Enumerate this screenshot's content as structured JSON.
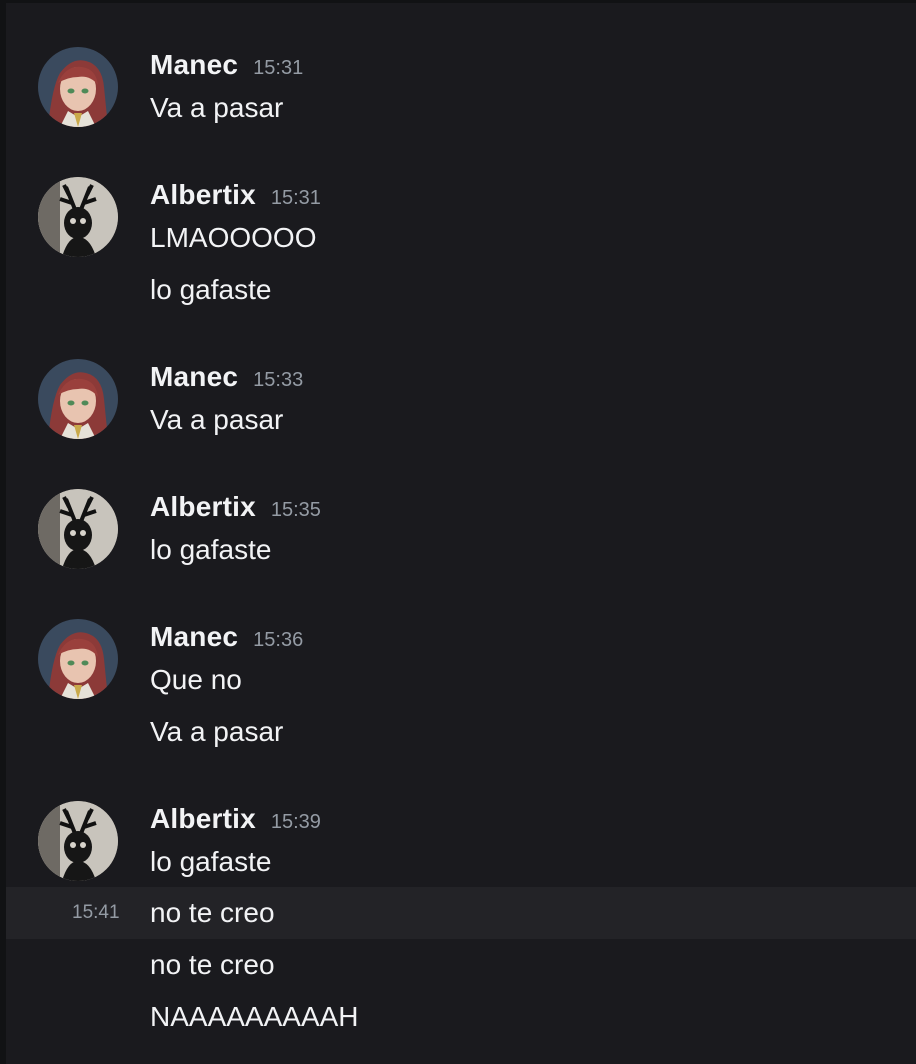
{
  "messages": [
    {
      "author": "Manec",
      "time": "15:31",
      "lines": [
        "Va a pasar"
      ]
    },
    {
      "author": "Albertix",
      "time": "15:31",
      "lines": [
        "LMAOOOOO",
        "lo gafaste"
      ]
    },
    {
      "author": "Manec",
      "time": "15:33",
      "lines": [
        "Va a pasar"
      ]
    },
    {
      "author": "Albertix",
      "time": "15:35",
      "lines": [
        "lo gafaste"
      ]
    },
    {
      "author": "Manec",
      "time": "15:36",
      "lines": [
        "Que no",
        "Va a pasar"
      ]
    },
    {
      "author": "Albertix",
      "time": "15:39",
      "lines": [
        "lo gafaste"
      ]
    }
  ],
  "followups": [
    {
      "hover_time": "15:41",
      "text": "no te creo"
    },
    {
      "text": "no te creo"
    },
    {
      "text": "NAAAAAAAAAH"
    }
  ],
  "colors": {
    "background": "#1a1a1e",
    "hover_background": "#232327",
    "username": "#f2f3f5",
    "timestamp": "#949ba4"
  },
  "icons": {
    "manec_avatar": "avatar-anime-redhead",
    "albertix_avatar": "avatar-antler-silhouette"
  }
}
